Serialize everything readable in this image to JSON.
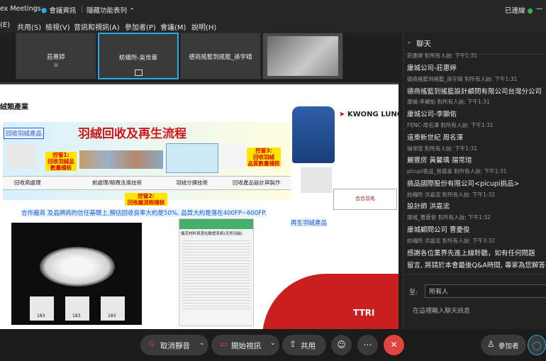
{
  "titlebar": {
    "app": "ex Meetings",
    "separator": "|",
    "security": "會議資訊",
    "hide_menu": "隱藏功能表列",
    "hide_menu_icon": "chevron-up-icon",
    "status": "已連線"
  },
  "menubar": {
    "items": [
      "(E)",
      "共用(S)",
      "檢視(V)",
      "音訊和視訊(A)",
      "參加者(P)",
      "會議(M)",
      "說明(H)"
    ]
  },
  "participants": [
    {
      "name": "莊惠婷",
      "sub": "米",
      "active": false
    },
    {
      "name": "紡織所-吳世華",
      "active": true
    },
    {
      "name": "德商搖籃到搖籃_孫宇晴",
      "active": false
    },
    {
      "name": "",
      "active": false
    }
  ],
  "slide": {
    "heading": "絨類產業",
    "brand": "KWONG LUNG",
    "panel_left_label": "回收羽絨產品",
    "title": "羽絨回收及再生流程",
    "tags": {
      "step1": "控管1:\n回收羽絨品\n數量稽核",
      "step3": "控管3:\n回收羽絨\n品質數量稽核",
      "step2": "控管2:\n回收廠流程稽核"
    },
    "steps": [
      "回收商處理",
      "前處理/精緻洗滌技術",
      "羽絨分揀技術",
      "回收產品設計與製作"
    ],
    "note": "合作廠商 及品牌商的信任基礎上,預估回收良率大約是50%, 品質大約是落在400FP~600FP.",
    "right_label": "再生羽絨產品",
    "cert_title": "儀克材料資源化驗證系統(天然羽絨)",
    "cert_num": "183",
    "footer_logo": "TTRI",
    "hl_text": "合合羽毛"
  },
  "chat": {
    "title": "聊天",
    "messages": [
      {
        "meta": "莊惠婷 對所有人說:   下午1:31",
        "text": ""
      },
      {
        "meta": "",
        "text": "康城公司-莊惠婷"
      },
      {
        "meta": "德商搖籃到搖籃_孫宇晴 對所有人說:   下午1:31",
        "text": ""
      },
      {
        "meta": "",
        "text": "德商搖籃到搖籃設計顧問有限公司台灣分公司"
      },
      {
        "meta": "康城-李顯佑 對所有人說:   下午1:31",
        "text": ""
      },
      {
        "meta": "",
        "text": "康城公司-李顯佑"
      },
      {
        "meta": "FENC-周名澤 對所有人說:   下午1:31",
        "text": ""
      },
      {
        "meta": "",
        "text": "遠東新世紀 周名澤"
      },
      {
        "meta": "揚常瑄 對所有人說:   下午1:31",
        "text": ""
      },
      {
        "meta": "",
        "text": "麗豐房 黃馨瑀 揚常瑄"
      },
      {
        "meta": "picupi挑品_張德喜 對所有人說:   下午1:31",
        "text": ""
      },
      {
        "meta": "",
        "text": "挑品國際股份有限公司<picupi挑品>"
      },
      {
        "meta": "紡織所 洪嘉浤 對所有人說:   下午1:32",
        "text": ""
      },
      {
        "meta": "",
        "text": "設計師 洪嘉浤"
      },
      {
        "meta": "康城_曹憂俊 對所有人說:   下午1:32",
        "text": ""
      },
      {
        "meta": "",
        "text": "康城顧問公司 曹憂俊"
      },
      {
        "meta": "紡織所 洪嘉浤 對所有人說:   下午3:32",
        "text": ""
      },
      {
        "meta": "",
        "text": "感謝各位業界先進上線聆聽，如有任何問題"
      },
      {
        "meta": "",
        "text": "留言, 將請於本會最後Q&A時間, 專家為您解答"
      }
    ],
    "to_label": "至:",
    "to_value": "所有人",
    "input_placeholder": "在這裡輸入聊天訊息"
  },
  "controls": {
    "mute": "取消靜音",
    "video": "開始視訊",
    "share": "共用",
    "participants": "參加者"
  },
  "colors": {
    "accent": "#2aa8e0",
    "red": "#e0443e",
    "yellow": "#ffe600",
    "green": "#3cb043"
  }
}
